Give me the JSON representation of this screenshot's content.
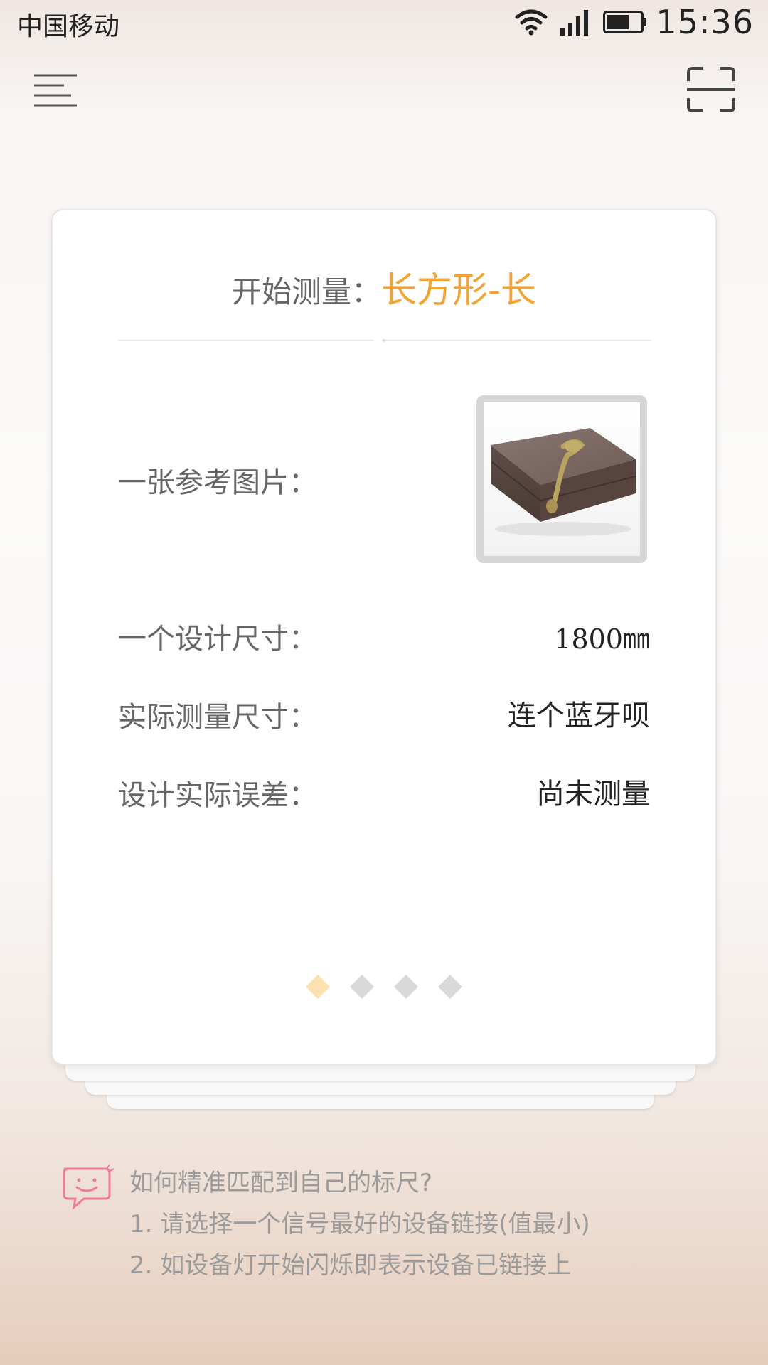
{
  "status_bar": {
    "carrier": "中国移动",
    "time": "15:36",
    "icons": [
      "wifi-icon",
      "signal-icon",
      "battery-icon"
    ]
  },
  "toolbar": {
    "menu_icon": "menu-icon",
    "scan_icon": "scan-icon"
  },
  "card": {
    "title_label": "开始测量：",
    "title_shape": "长方形-长",
    "reference_image_label": "一张参考图片：",
    "design_size_label": "一个设计尺寸：",
    "design_size_value": "1800㎜",
    "actual_size_label": "实际测量尺寸：",
    "actual_size_value": "连个蓝牙呗",
    "error_label": "设计实际误差：",
    "error_value": "尚未测量",
    "pager": {
      "count": 4,
      "active_index": 0
    }
  },
  "tips": {
    "icon": "smiley-chat-icon",
    "question": "如何精准匹配到自己的标尺?",
    "line1": "1. 请选择一个信号最好的设备链接(值最小)",
    "line2": "2. 如设备灯开始闪烁即表示设备已链接上"
  },
  "colors": {
    "accent": "#f3a334",
    "pager_active": "#fce0b0",
    "pager_inactive": "#d9d9d9",
    "tips_icon": "#f07a9a",
    "tips_text": "#9b9b9b"
  }
}
